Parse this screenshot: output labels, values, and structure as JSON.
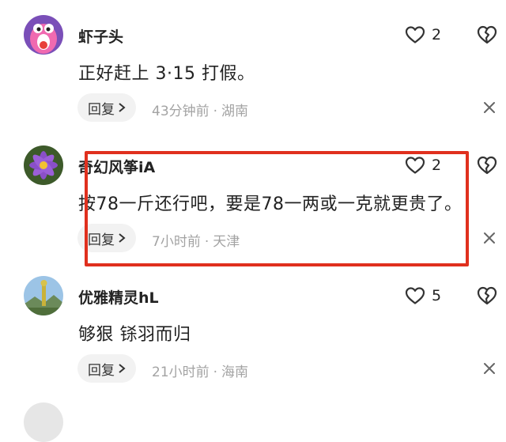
{
  "comments": [
    {
      "username": "虾子头",
      "text": "正好赶上 3·15 打假。",
      "likes": "2",
      "reply_label": "回复",
      "time": "43分钟前",
      "location": "湖南",
      "avatar": "pink-cartoon-avatar"
    },
    {
      "username": "奇幻风筝iA",
      "text": "按78一斤还行吧，要是78一两或一克就更贵了。",
      "likes": "2",
      "reply_label": "回复",
      "time": "7小时前",
      "location": "天津",
      "avatar": "purple-lotus-avatar"
    },
    {
      "username": "优雅精灵hL",
      "text": "够狠 铩羽而归",
      "likes": "5",
      "reply_label": "回复",
      "time": "21小时前",
      "location": "海南",
      "avatar": "landscape-avatar"
    }
  ],
  "separator": "·",
  "colors": {
    "highlight": "#e0301e",
    "meta_text": "#a3a3a3",
    "reply_bg": "#f2f2f2"
  }
}
